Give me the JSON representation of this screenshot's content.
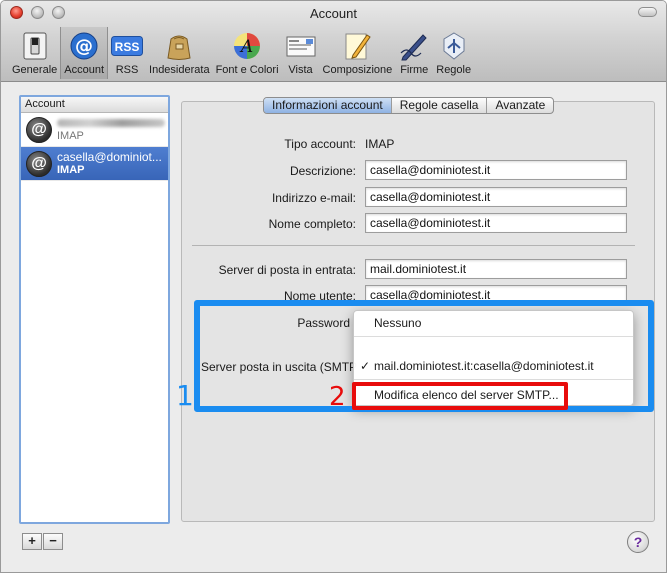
{
  "window": {
    "title": "Account"
  },
  "toolbar": {
    "items": [
      {
        "label": "Generale",
        "icon": "light-switch-icon"
      },
      {
        "label": "Account",
        "icon": "at-sign-icon"
      },
      {
        "label": "RSS",
        "icon": "rss-icon"
      },
      {
        "label": "Indesiderata",
        "icon": "junk-bag-icon"
      },
      {
        "label": "Font e Colori",
        "icon": "font-colors-icon"
      },
      {
        "label": "Vista",
        "icon": "vista-icon"
      },
      {
        "label": "Composizione",
        "icon": "compose-pencil-icon"
      },
      {
        "label": "Firme",
        "icon": "signature-pen-icon"
      },
      {
        "label": "Regole",
        "icon": "rules-icon"
      }
    ],
    "selected": "Account"
  },
  "sidebar": {
    "header": "Account",
    "accounts": [
      {
        "name": "",
        "type": "IMAP",
        "redacted": true
      },
      {
        "name": "casella@dominiot...",
        "type": "IMAP",
        "selected": true
      }
    ],
    "add_label": "+",
    "remove_label": "−"
  },
  "tabs": {
    "items": [
      "Informazioni account",
      "Regole casella",
      "Avanzate"
    ],
    "active": "Informazioni account"
  },
  "form": {
    "account_type_label": "Tipo account:",
    "account_type_value": "IMAP",
    "description_label": "Descrizione:",
    "description_value": "casella@dominiotest.it",
    "email_label": "Indirizzo e-mail:",
    "email_value": "casella@dominiotest.it",
    "fullname_label": "Nome completo:",
    "fullname_value": "casella@dominiotest.it",
    "incoming_server_label": "Server di posta in entrata:",
    "incoming_server_value": "mail.dominiotest.it",
    "username_label": "Nome utente:",
    "username_value": "casella@dominiotest.it",
    "password_label": "Password",
    "outgoing_server_label": "Server posta in uscita (SMTP"
  },
  "smtp_menu": {
    "items": [
      {
        "label": "Nessuno"
      },
      {
        "label": "mail.dominiotest.it:casella@dominiotest.it",
        "checked": true
      },
      {
        "label": "Modifica elenco del server SMTP..."
      }
    ],
    "check_mark": "✓"
  },
  "annotations": {
    "blue_number": "1",
    "red_number": "2",
    "blue_color": "#1a8cf0",
    "red_color": "#e80c0c"
  },
  "help": {
    "label": "?"
  }
}
